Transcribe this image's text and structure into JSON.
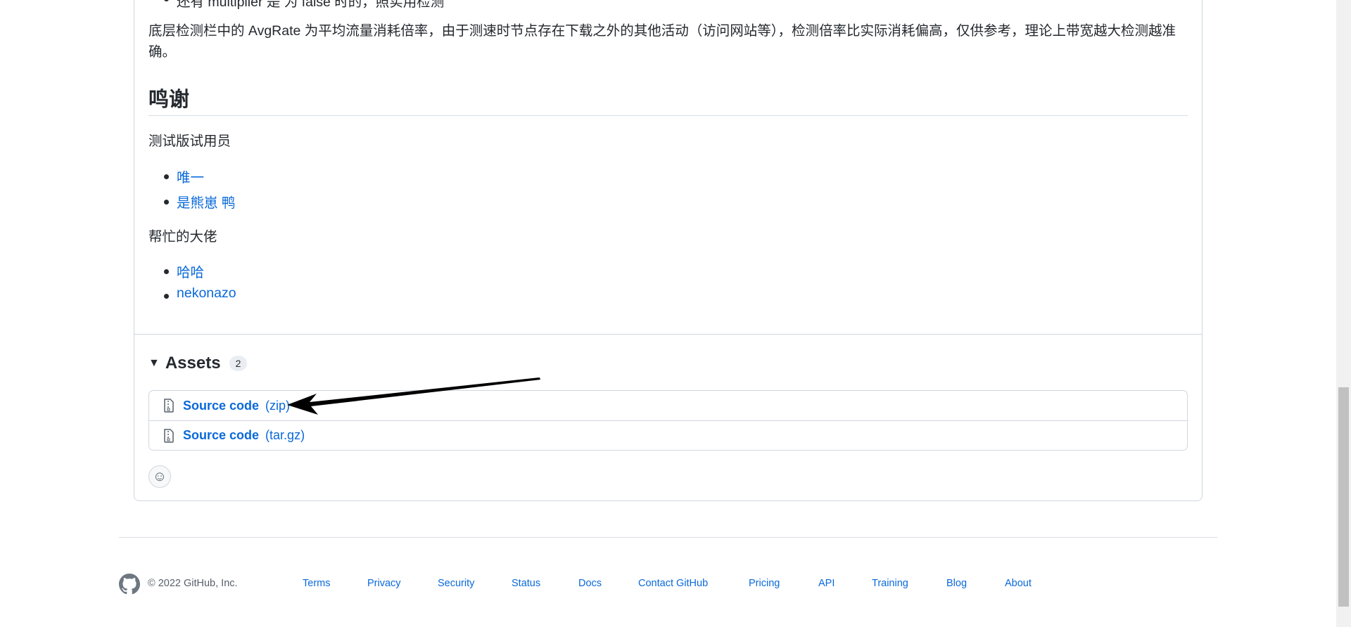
{
  "release_body": {
    "clipped_line": "还有 multiplier 是 为 false 时的，照实用检测",
    "avgrate_paragraph": "底层检测栏中的 AvgRate 为平均流量消耗倍率，由于测速时节点存在下载之外的其他活动（访问网站等），检测倍率比实际消耗偏高，仅供参考，理论上带宽越大检测越准确。",
    "thanks_heading": "鸣谢",
    "testers_label": "测试版试用员",
    "testers": [
      "唯一",
      "是熊崽 鸭"
    ],
    "helpers_label": "帮忙的大佬",
    "helpers": [
      "哈哈",
      "nekonazo"
    ]
  },
  "assets": {
    "title": "Assets",
    "count": "2",
    "items": [
      {
        "name": "Source code",
        "ext": "(zip)"
      },
      {
        "name": "Source code",
        "ext": "(tar.gz)"
      }
    ]
  },
  "footer": {
    "copyright": "© 2022 GitHub, Inc.",
    "links": [
      "Terms",
      "Privacy",
      "Security",
      "Status",
      "Docs",
      "Contact GitHub",
      "Pricing",
      "API",
      "Training",
      "Blog",
      "About"
    ]
  }
}
